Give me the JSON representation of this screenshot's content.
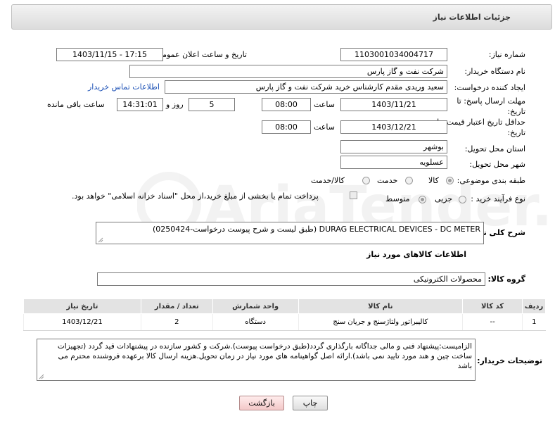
{
  "header": {
    "title": "جزئیات اطلاعات نیاز"
  },
  "form": {
    "need_number_label": "شماره نیاز:",
    "need_number": "1103001034004717",
    "announce_label": "تاریخ و ساعت اعلان عمومی:",
    "announce_value": "1403/11/15 - 17:15",
    "buyer_org_label": "نام دستگاه خریدار:",
    "buyer_org": "شرکت نفت و گاز پارس",
    "creator_label": "ایجاد کننده درخواست:",
    "creator": "سعید وریدی مقدم کارشناس خرید شرکت نفت و گاز پارس",
    "contact_link": "اطلاعات تماس خریدار",
    "deadline_label": "مهلت ارسال پاسخ: تا تاریخ:",
    "deadline_date": "1403/11/21",
    "time_word": "ساعت",
    "deadline_time": "08:00",
    "days_value": "5",
    "days_word": "روز و",
    "remaining_time": "14:31:01",
    "remaining_word": "ساعت باقی مانده",
    "validity_label": "حداقل تاریخ اعتبار قیمت: تا تاریخ:",
    "validity_date": "1403/12/21",
    "validity_time": "08:00",
    "province_label": "استان محل تحویل:",
    "province": "بوشهر",
    "city_label": "شهر محل تحویل:",
    "city": "عسلویه",
    "category_label": "طبقه بندی موضوعی:",
    "category_options": [
      "کالا",
      "خدمت",
      "کالا/خدمت"
    ],
    "category_selected": "کالا",
    "process_label": "نوع فرآیند خرید :",
    "process_options": [
      "جزیی",
      "متوسط"
    ],
    "process_selected": "متوسط",
    "payment_note": "پرداخت تمام یا بخشی از مبلغ خرید،از محل \"اسناد خزانه اسلامی\" خواهد بود."
  },
  "description": {
    "label": "شرح کلی نیاز:",
    "value": "DURAG ELECTRICAL DEVICES - DC METER (طبق لیست و شرح پیوست درخواست-0250424)"
  },
  "goods": {
    "section_title": "اطلاعات کالاهای مورد نیاز",
    "group_label": "گروه کالا:",
    "group_value": "محصولات الکترونیکی",
    "columns": [
      "ردیف",
      "کد کالا",
      "نام کالا",
      "واحد شمارش",
      "تعداد / مقدار",
      "تاریخ نیاز"
    ],
    "rows": [
      {
        "row": "1",
        "code": "--",
        "name": "کالیبراتور ولتاژسنج و جریان سنج",
        "unit": "دستگاه",
        "qty": "2",
        "date": "1403/12/21"
      }
    ]
  },
  "buyer_notes": {
    "label": "توضیحات خریدار:",
    "text": "الزامیست:پیشنهاد فنی و مالی  جداگانه بارگذاری گردد(طبق درخواست پیوست).شرکت و کشور سازنده در پیشنهادات قید گردد (تجهیزات ساخت چین و هند مورد تایید نمی باشد).ارائه اصل گواهینامه های مورد نیاز در زمان تحویل.هزینه ارسال کالا برعهده فروشنده محترم می باشد"
  },
  "buttons": {
    "print": "چاپ",
    "back": "بازگشت"
  },
  "watermark": {
    "text": "AriaTender.neT"
  },
  "colors": {
    "link": "#1a4fb5",
    "header_bg": "#e6e6e6",
    "table_header": "#e3e3e3",
    "back_button": "#f3c8c8"
  }
}
